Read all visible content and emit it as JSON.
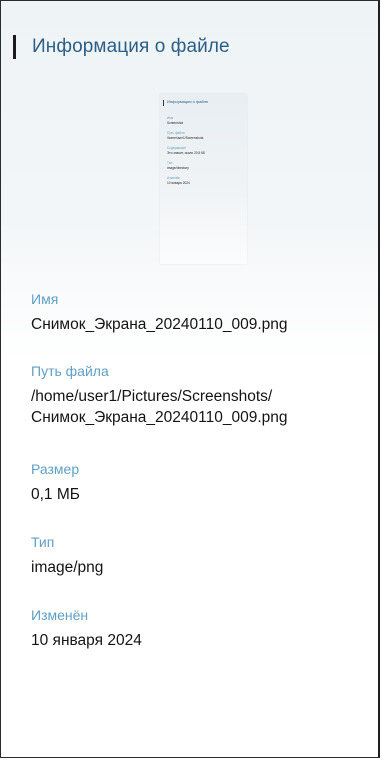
{
  "header": {
    "title": "Информация о файле"
  },
  "thumbnail": {
    "title": "Информация о файле",
    "lines": [
      {
        "label": "Имя",
        "value": "Screenshot"
      },
      {
        "label": "Путь файла",
        "value": "/home/user1/Screenshots"
      },
      {
        "label": "Содержимое",
        "value": "Это значит, около 20,5 КБ"
      },
      {
        "label": "Тип",
        "value": "image/directory"
      },
      {
        "label": "Изменён",
        "value": "10 января 2024"
      }
    ]
  },
  "fields": {
    "name": {
      "label": "Имя",
      "value": "Снимок_Экрана_20240110_009.png"
    },
    "path": {
      "label": "Путь файла",
      "value_line1": "/home/user1/Pictures/Screenshots/",
      "value_line2": "Снимок_Экрана_20240110_009.png"
    },
    "size": {
      "label": "Размер",
      "value": "0,1 МБ"
    },
    "type": {
      "label": "Тип",
      "value": "image/png"
    },
    "modified": {
      "label": "Изменён",
      "value": "10 января 2024"
    }
  }
}
